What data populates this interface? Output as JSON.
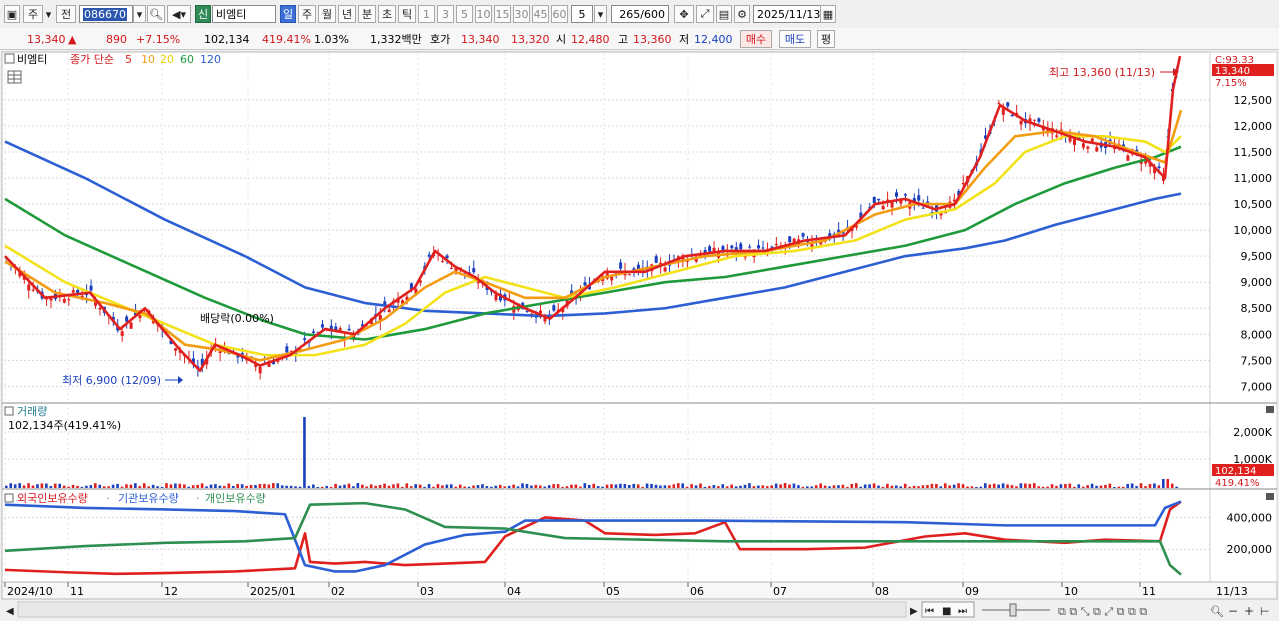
{
  "toolbar": {
    "market_btn": "주",
    "prev_btn": "전",
    "code": "086670",
    "stock_badge": "신",
    "stock_name": "비엠티",
    "period_tabs": [
      "일",
      "주",
      "월",
      "년",
      "분",
      "초",
      "틱"
    ],
    "interval_btns": [
      "1",
      "3",
      "5",
      "10",
      "15",
      "30",
      "45",
      "60"
    ],
    "count_value": "5",
    "count_display": "265",
    "count_total": "/600",
    "date_value": "2025/11/13"
  },
  "info": {
    "price": "13,340",
    "arrow": "▲",
    "change": "890",
    "change_pct": "+7.15%",
    "volume": "102,134",
    "volume_pct": "419.41%",
    "turnover_pct": "1.03%",
    "amount": "1,332백만",
    "quote_label": "호가",
    "ask": "13,340",
    "bid": "13,320",
    "open_label": "시",
    "open": "12,480",
    "high_label": "고",
    "high": "13,360",
    "low_label": "저",
    "low": "12,400",
    "buy_btn": "매수",
    "sell_btn": "매도",
    "eval_btn": "평"
  },
  "price_panel": {
    "stock_label": "비엠티",
    "legend_prefix": "종가 단순",
    "ma_periods": [
      "5",
      "10",
      "20",
      "60",
      "120"
    ],
    "ma_colors": [
      "#e0201e",
      "#f39c12",
      "#f3e21a",
      "#1f9a3a",
      "#2c5fd4"
    ],
    "price_tag": "13,340",
    "c_label": "C:93.33",
    "pct_label": "7.15%",
    "high_annot": "최고 13,360 (11/13)",
    "low_annot": "최저 6,900 (12/09)",
    "div_annot": "배당락(0.00%)",
    "y_ticks": [
      "12,500",
      "12,000",
      "11,500",
      "11,000",
      "10,500",
      "10,000",
      "9,500",
      "9,000",
      "8,500",
      "8,000",
      "7,500",
      "7,000"
    ]
  },
  "volume_panel": {
    "title": "거래량",
    "info": "102,134주(419.41%)",
    "y_ticks": [
      "2,000K",
      "1,000K"
    ],
    "tag_value": "102,134",
    "tag_pct": "419.41%"
  },
  "holding_panel": {
    "foreign_label": "외국인보유수량",
    "inst_label": "기관보유수량",
    "indiv_label": "개인보유수량",
    "y_ticks": [
      "400,000",
      "200,000"
    ]
  },
  "x_axis": {
    "labels": [
      "2024/10",
      "11",
      "12",
      "2025/01",
      "02",
      "03",
      "04",
      "05",
      "06",
      "07",
      "08",
      "09",
      "10",
      "11"
    ],
    "last_label": "11/13"
  },
  "chart_data": {
    "type": "line",
    "series": [
      {
        "name": "5",
        "color": "#e0201e",
        "values": [
          [
            0,
            9500
          ],
          [
            40,
            8700
          ],
          [
            85,
            8800
          ],
          [
            115,
            8100
          ],
          [
            140,
            8500
          ],
          [
            175,
            7700
          ],
          [
            195,
            7300
          ],
          [
            210,
            7800
          ],
          [
            235,
            7600
          ],
          [
            255,
            7400
          ],
          [
            285,
            7600
          ],
          [
            320,
            8100
          ],
          [
            350,
            8000
          ],
          [
            380,
            8500
          ],
          [
            410,
            8900
          ],
          [
            430,
            9600
          ],
          [
            450,
            9300
          ],
          [
            470,
            9100
          ],
          [
            490,
            8800
          ],
          [
            520,
            8500
          ],
          [
            545,
            8300
          ],
          [
            570,
            8700
          ],
          [
            600,
            9200
          ],
          [
            640,
            9200
          ],
          [
            680,
            9500
          ],
          [
            720,
            9600
          ],
          [
            760,
            9600
          ],
          [
            800,
            9800
          ],
          [
            840,
            9900
          ],
          [
            870,
            10500
          ],
          [
            900,
            10600
          ],
          [
            930,
            10400
          ],
          [
            950,
            10500
          ],
          [
            975,
            11400
          ],
          [
            995,
            12400
          ],
          [
            1020,
            12100
          ],
          [
            1050,
            11900
          ],
          [
            1080,
            11700
          ],
          [
            1110,
            11600
          ],
          [
            1140,
            11400
          ],
          [
            1160,
            11000
          ],
          [
            1168,
            12700
          ],
          [
            1175,
            13340
          ]
        ]
      },
      {
        "name": "10",
        "color": "#f39c12",
        "values": [
          [
            0,
            9400
          ],
          [
            50,
            8800
          ],
          [
            100,
            8600
          ],
          [
            140,
            8400
          ],
          [
            180,
            7800
          ],
          [
            215,
            7700
          ],
          [
            255,
            7500
          ],
          [
            300,
            7700
          ],
          [
            340,
            7900
          ],
          [
            380,
            8300
          ],
          [
            420,
            8900
          ],
          [
            450,
            9200
          ],
          [
            480,
            9000
          ],
          [
            520,
            8700
          ],
          [
            560,
            8700
          ],
          [
            600,
            9100
          ],
          [
            650,
            9300
          ],
          [
            700,
            9500
          ],
          [
            760,
            9600
          ],
          [
            820,
            9800
          ],
          [
            870,
            10300
          ],
          [
            910,
            10500
          ],
          [
            950,
            10500
          ],
          [
            980,
            11200
          ],
          [
            1010,
            11800
          ],
          [
            1050,
            11900
          ],
          [
            1090,
            11800
          ],
          [
            1130,
            11500
          ],
          [
            1160,
            11300
          ],
          [
            1176,
            12300
          ]
        ]
      },
      {
        "name": "20",
        "color": "#f3e21a",
        "values": [
          [
            0,
            9700
          ],
          [
            60,
            9000
          ],
          [
            110,
            8600
          ],
          [
            160,
            8200
          ],
          [
            210,
            7800
          ],
          [
            260,
            7600
          ],
          [
            310,
            7600
          ],
          [
            360,
            7800
          ],
          [
            400,
            8200
          ],
          [
            440,
            8800
          ],
          [
            480,
            9100
          ],
          [
            520,
            8900
          ],
          [
            560,
            8700
          ],
          [
            610,
            8900
          ],
          [
            670,
            9200
          ],
          [
            730,
            9500
          ],
          [
            790,
            9600
          ],
          [
            850,
            9800
          ],
          [
            900,
            10200
          ],
          [
            950,
            10400
          ],
          [
            990,
            10900
          ],
          [
            1020,
            11500
          ],
          [
            1060,
            11800
          ],
          [
            1100,
            11800
          ],
          [
            1140,
            11700
          ],
          [
            1160,
            11500
          ],
          [
            1176,
            11800
          ]
        ]
      },
      {
        "name": "60",
        "color": "#1f9a3a",
        "values": [
          [
            0,
            10600
          ],
          [
            60,
            9900
          ],
          [
            130,
            9300
          ],
          [
            200,
            8700
          ],
          [
            260,
            8250
          ],
          [
            300,
            8000
          ],
          [
            360,
            7900
          ],
          [
            420,
            8100
          ],
          [
            480,
            8400
          ],
          [
            540,
            8600
          ],
          [
            600,
            8800
          ],
          [
            660,
            9000
          ],
          [
            720,
            9100
          ],
          [
            780,
            9300
          ],
          [
            840,
            9500
          ],
          [
            900,
            9700
          ],
          [
            960,
            10000
          ],
          [
            1010,
            10500
          ],
          [
            1060,
            10900
          ],
          [
            1110,
            11200
          ],
          [
            1150,
            11400
          ],
          [
            1176,
            11600
          ]
        ]
      },
      {
        "name": "120",
        "color": "#2c5fd4",
        "values": [
          [
            0,
            11700
          ],
          [
            80,
            11000
          ],
          [
            160,
            10200
          ],
          [
            240,
            9500
          ],
          [
            300,
            8900
          ],
          [
            360,
            8600
          ],
          [
            420,
            8450
          ],
          [
            480,
            8400
          ],
          [
            540,
            8350
          ],
          [
            600,
            8400
          ],
          [
            660,
            8500
          ],
          [
            720,
            8700
          ],
          [
            780,
            8900
          ],
          [
            840,
            9200
          ],
          [
            900,
            9500
          ],
          [
            960,
            9650
          ],
          [
            1000,
            9800
          ],
          [
            1050,
            10100
          ],
          [
            1100,
            10350
          ],
          [
            1150,
            10600
          ],
          [
            1176,
            10700
          ]
        ]
      }
    ],
    "price_ylim": [
      6700,
      13400
    ],
    "volume_spike_x": 303,
    "holdings": [
      {
        "name": "외국인보유수량",
        "color": "#e0201e",
        "values": [
          [
            0,
            70000
          ],
          [
            60,
            55000
          ],
          [
            110,
            45000
          ],
          [
            160,
            50000
          ],
          [
            230,
            60000
          ],
          [
            290,
            80000
          ],
          [
            300,
            300000
          ],
          [
            305,
            120000
          ],
          [
            330,
            110000
          ],
          [
            360,
            120000
          ],
          [
            400,
            100000
          ],
          [
            440,
            110000
          ],
          [
            480,
            120000
          ],
          [
            500,
            280000
          ],
          [
            540,
            400000
          ],
          [
            580,
            380000
          ],
          [
            600,
            300000
          ],
          [
            650,
            290000
          ],
          [
            690,
            300000
          ],
          [
            720,
            370000
          ],
          [
            735,
            200000
          ],
          [
            800,
            200000
          ],
          [
            860,
            210000
          ],
          [
            920,
            280000
          ],
          [
            960,
            300000
          ],
          [
            1000,
            260000
          ],
          [
            1060,
            240000
          ],
          [
            1100,
            260000
          ],
          [
            1155,
            250000
          ],
          [
            1165,
            450000
          ],
          [
            1176,
            500000
          ]
        ]
      },
      {
        "name": "기관보유수량",
        "color": "#2c5fd4",
        "values": [
          [
            0,
            480000
          ],
          [
            80,
            460000
          ],
          [
            160,
            450000
          ],
          [
            230,
            440000
          ],
          [
            280,
            420000
          ],
          [
            300,
            100000
          ],
          [
            330,
            60000
          ],
          [
            350,
            60000
          ],
          [
            380,
            100000
          ],
          [
            420,
            230000
          ],
          [
            460,
            290000
          ],
          [
            500,
            310000
          ],
          [
            520,
            380000
          ],
          [
            600,
            380000
          ],
          [
            700,
            380000
          ],
          [
            900,
            370000
          ],
          [
            1000,
            350000
          ],
          [
            1150,
            350000
          ],
          [
            1160,
            460000
          ],
          [
            1176,
            500000
          ]
        ]
      },
      {
        "name": "개인보유수량",
        "color": "#2f8f50",
        "values": [
          [
            0,
            190000
          ],
          [
            80,
            220000
          ],
          [
            160,
            240000
          ],
          [
            240,
            250000
          ],
          [
            290,
            270000
          ],
          [
            305,
            480000
          ],
          [
            360,
            490000
          ],
          [
            400,
            450000
          ],
          [
            440,
            340000
          ],
          [
            500,
            330000
          ],
          [
            560,
            270000
          ],
          [
            640,
            260000
          ],
          [
            720,
            250000
          ],
          [
            800,
            250000
          ],
          [
            900,
            250000
          ],
          [
            1000,
            250000
          ],
          [
            1100,
            250000
          ],
          [
            1155,
            250000
          ],
          [
            1165,
            100000
          ],
          [
            1176,
            40000
          ]
        ]
      }
    ],
    "holding_ylim": [
      0,
      560000
    ]
  }
}
